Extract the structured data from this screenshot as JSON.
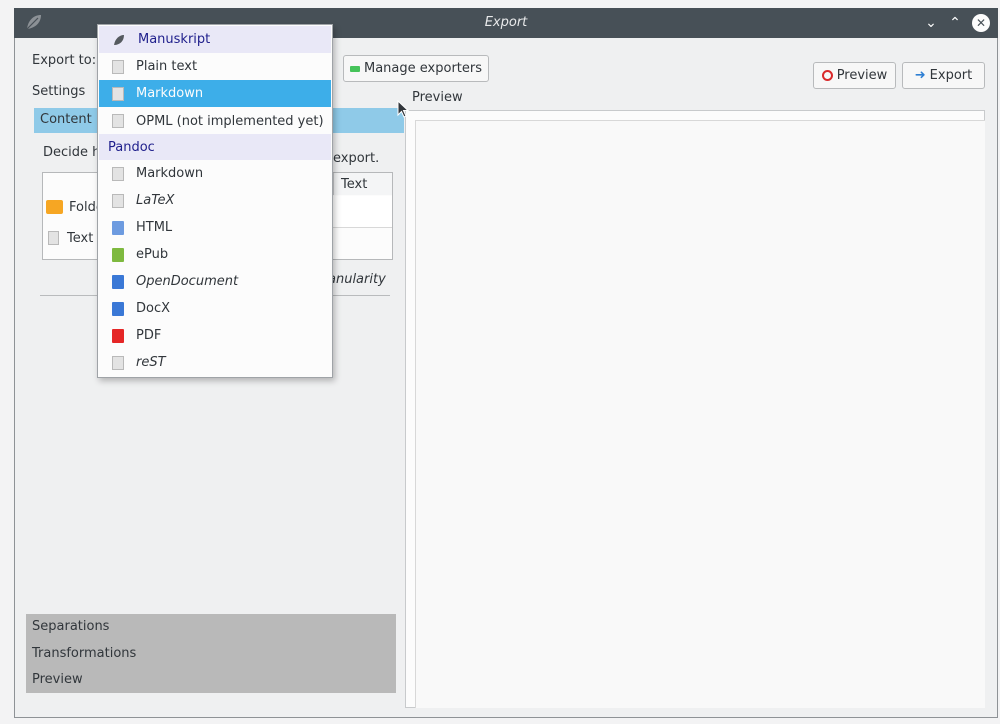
{
  "window": {
    "title": "Export",
    "controls": {
      "minimize": "⌄",
      "maximize": "⌃",
      "close": "✕"
    }
  },
  "export_to_label": "Export to:",
  "manage_exporters_label": "Manage exporters",
  "preview_button_label": "Preview",
  "export_button_label": "Export",
  "preview_section_label": "Preview",
  "settings_label": "Settings",
  "toolbox": {
    "content_tab": "Content",
    "description_start": "Decide h",
    "description_end": "export.",
    "tree_col_text": "Text",
    "tree_rows": [
      "Folde",
      "Text"
    ],
    "granularity_fragment": "anularity",
    "sections": [
      "Separations",
      "Transformations",
      "Preview"
    ]
  },
  "dropdown": {
    "groups": [
      {
        "header": "Manuskript",
        "header_icon": "manuskript-leaf-icon",
        "items": [
          {
            "label": "Plain text",
            "icon": "text-doc-icon",
            "italic": false,
            "selected": false
          },
          {
            "label": "Markdown",
            "icon": "markdown-doc-icon",
            "italic": false,
            "selected": true
          },
          {
            "label": "OPML (not implemented yet)",
            "icon": "opml-doc-icon",
            "italic": false,
            "selected": false
          }
        ]
      },
      {
        "header": "Pandoc",
        "items": [
          {
            "label": "Markdown",
            "icon": "markdown-doc-icon",
            "italic": false,
            "selected": false
          },
          {
            "label": "LaTeX",
            "icon": "latex-doc-icon",
            "italic": true,
            "selected": false
          },
          {
            "label": "HTML",
            "icon": "html-doc-icon",
            "italic": false,
            "selected": false
          },
          {
            "label": "ePub",
            "icon": "epub-doc-icon",
            "italic": false,
            "selected": false
          },
          {
            "label": "OpenDocument",
            "icon": "opendocument-doc-icon",
            "italic": true,
            "selected": false
          },
          {
            "label": "DocX",
            "icon": "docx-doc-icon",
            "italic": false,
            "selected": false
          },
          {
            "label": "PDF",
            "icon": "pdf-doc-icon",
            "italic": false,
            "selected": false
          },
          {
            "label": "reST",
            "icon": "rest-doc-icon",
            "italic": true,
            "selected": false
          }
        ]
      }
    ]
  },
  "colors": {
    "selection": "#3daee9",
    "tab_header": "#8fcae8",
    "group_header_bg": "#e9e8f7",
    "group_header_text": "#1f1f8c"
  }
}
